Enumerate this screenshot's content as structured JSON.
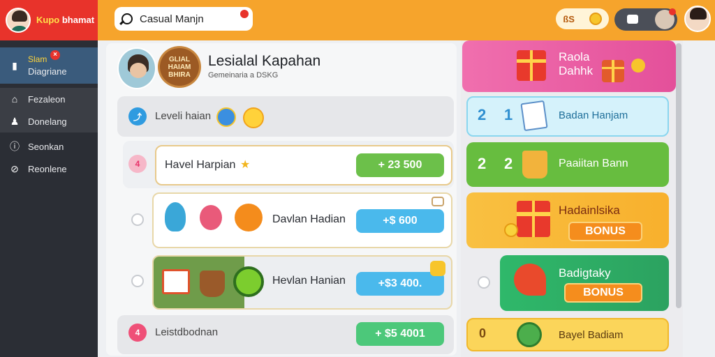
{
  "brand": {
    "name_line1": "Kupo",
    "name_line2": "bhamat"
  },
  "search": {
    "value": "Casual Manjn"
  },
  "topbar": {
    "coin_text": "ßS"
  },
  "sidebar": {
    "items": [
      {
        "label_top": "Slam",
        "label": "Diagriane"
      },
      {
        "label": "Fezaleon"
      },
      {
        "label": "Donelang"
      },
      {
        "label": "Seonkan"
      },
      {
        "label": "Reonlene"
      }
    ]
  },
  "profile": {
    "name": "Lesialal Kapahan",
    "subtitle": "Gemeinaria a DSKG",
    "badge_text": "GLIAL HAIAM BHIRA"
  },
  "list": {
    "header": {
      "label": "Leveli haian"
    },
    "rows": [
      {
        "index": "4",
        "label": "Havel Harpian",
        "amount": "+ 23 500"
      },
      {
        "label": "Davlan Hadian",
        "amount": "+$ 600"
      },
      {
        "label": "Hevlan Hanian",
        "amount": "+$3 400."
      },
      {
        "index": "4",
        "label": "Leistdbodnan",
        "amount": "+ $5 4001"
      }
    ]
  },
  "cards": [
    {
      "title_line1": "Raola",
      "title_line2": "Dahhk"
    },
    {
      "num1": "2",
      "num2": "1",
      "title": "Badan Hanjam"
    },
    {
      "num1": "2",
      "num2": "2",
      "title": "Paaiitan Bann"
    },
    {
      "title": "Hadainlsika",
      "bonus": "BONUS"
    },
    {
      "title": "Badigtaky",
      "bonus": "BONUS"
    },
    {
      "num": "0",
      "title": "Bayel Badiam"
    }
  ]
}
